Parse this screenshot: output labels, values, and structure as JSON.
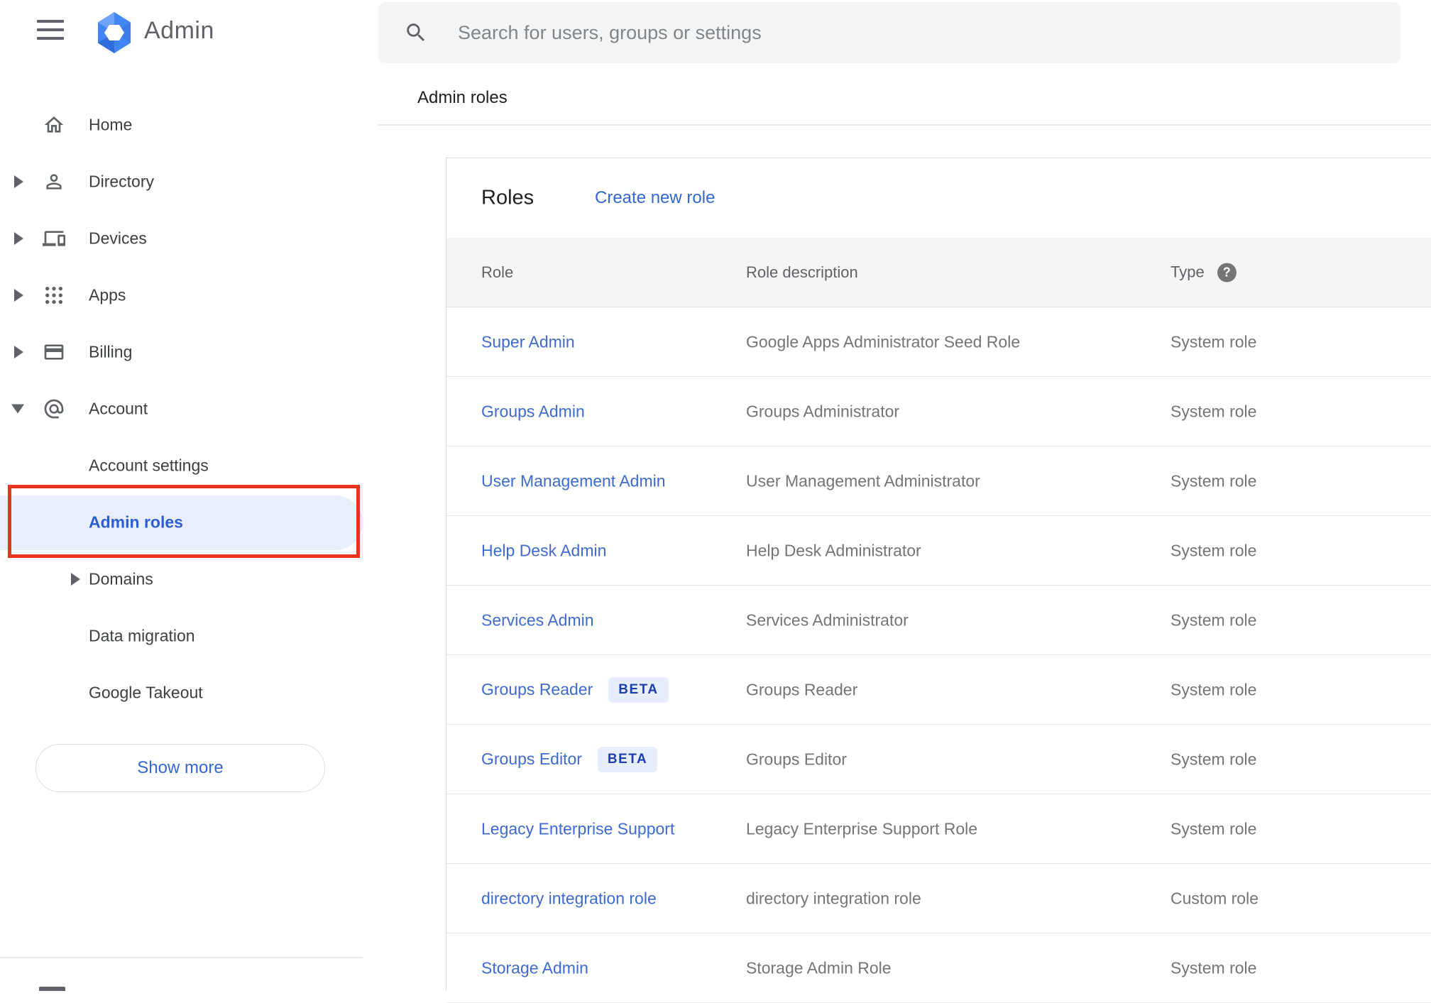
{
  "sidebar": {
    "brand": {
      "app_name": "Admin"
    },
    "items": [
      {
        "id": "home",
        "label": "Home",
        "icon": "home-icon",
        "arrow": null,
        "level": 0,
        "active": false
      },
      {
        "id": "directory",
        "label": "Directory",
        "icon": "person-icon",
        "arrow": "right",
        "level": 0,
        "active": false
      },
      {
        "id": "devices",
        "label": "Devices",
        "icon": "devices-icon",
        "arrow": "right",
        "level": 0,
        "active": false
      },
      {
        "id": "apps",
        "label": "Apps",
        "icon": "apps-grid-icon",
        "arrow": "right",
        "level": 0,
        "active": false
      },
      {
        "id": "billing",
        "label": "Billing",
        "icon": "credit-card-icon",
        "arrow": "right",
        "level": 0,
        "active": false
      },
      {
        "id": "account",
        "label": "Account",
        "icon": "at-sign-icon",
        "arrow": "down",
        "level": 0,
        "active": false
      },
      {
        "id": "account-settings",
        "label": "Account settings",
        "icon": null,
        "arrow": null,
        "level": 1,
        "active": false
      },
      {
        "id": "admin-roles",
        "label": "Admin roles",
        "icon": null,
        "arrow": null,
        "level": 1,
        "active": true
      },
      {
        "id": "domains",
        "label": "Domains",
        "icon": null,
        "arrow": "right-sub",
        "level": 1,
        "active": false
      },
      {
        "id": "data-migration",
        "label": "Data migration",
        "icon": null,
        "arrow": null,
        "level": 1,
        "active": false
      },
      {
        "id": "google-takeout",
        "label": "Google Takeout",
        "icon": null,
        "arrow": null,
        "level": 1,
        "active": false
      }
    ],
    "show_more_label": "Show more"
  },
  "topbar": {
    "search_placeholder": "Search for users, groups or settings",
    "breadcrumb": "Admin roles"
  },
  "main": {
    "card_title": "Roles",
    "create_link": "Create new role",
    "table": {
      "columns": [
        "Role",
        "Role description",
        "Type"
      ],
      "help_icon_glyph": "?",
      "rows": [
        {
          "role": "Super Admin",
          "beta": false,
          "description": "Google Apps Administrator Seed Role",
          "type": "System role"
        },
        {
          "role": "Groups Admin",
          "beta": false,
          "description": "Groups Administrator",
          "type": "System role"
        },
        {
          "role": "User Management Admin",
          "beta": false,
          "description": "User Management Administrator",
          "type": "System role"
        },
        {
          "role": "Help Desk Admin",
          "beta": false,
          "description": "Help Desk Administrator",
          "type": "System role"
        },
        {
          "role": "Services Admin",
          "beta": false,
          "description": "Services Administrator",
          "type": "System role"
        },
        {
          "role": "Groups Reader",
          "beta": true,
          "description": "Groups Reader",
          "type": "System role"
        },
        {
          "role": "Groups Editor",
          "beta": true,
          "description": "Groups Editor",
          "type": "System role"
        },
        {
          "role": "Legacy Enterprise Support",
          "beta": false,
          "description": "Legacy Enterprise Support Role",
          "type": "System role"
        },
        {
          "role": "directory integration role",
          "beta": false,
          "description": "directory integration role",
          "type": "Custom role"
        },
        {
          "role": "Storage Admin",
          "beta": false,
          "description": "Storage Admin Role",
          "type": "System role"
        }
      ],
      "beta_label": "BETA"
    }
  },
  "annotation": {
    "highlight_box_color": "#e8341c"
  },
  "colors": {
    "link_blue": "#3e6ad1",
    "action_blue": "#3367d6",
    "active_item_blue": "#2b5dd5",
    "active_item_bg": "#e8eefb",
    "beta_bg": "#e8edfb",
    "beta_text": "#1d3fae",
    "header_row_bg": "#f5f5f5",
    "logo_blue": "#4285f4"
  }
}
